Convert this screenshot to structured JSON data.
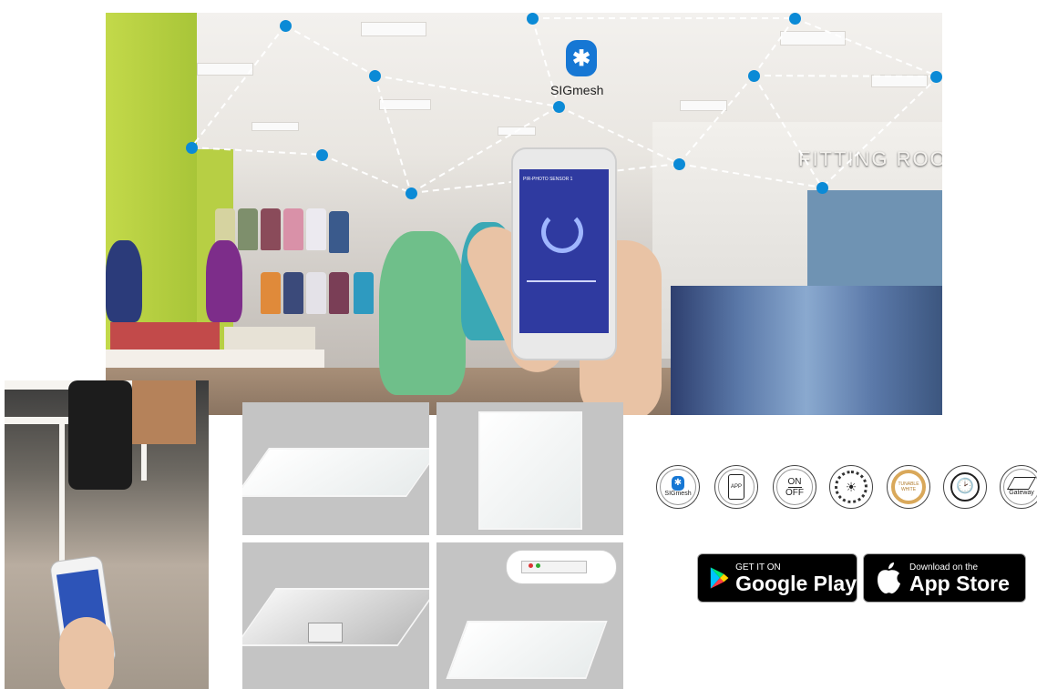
{
  "hero": {
    "protocol_label": "SIGmesh",
    "bluetooth_icon": "bluetooth-icon",
    "sign_text": "FITTING ROO",
    "phone_title": "PIR-PHOTO SENSOR 1"
  },
  "feature_icons": [
    {
      "icon": "bluetooth-icon",
      "label": "SIGmesh"
    },
    {
      "icon": "smartphone-icon",
      "label": "APP"
    },
    {
      "icon": "power-icon",
      "label": "ON",
      "label2": "OFF"
    },
    {
      "icon": "dimming-icon",
      "label": ""
    },
    {
      "icon": "color-temperature-icon",
      "label": "TUNABLE",
      "label2": "WHITE"
    },
    {
      "icon": "clock-icon",
      "label": ""
    },
    {
      "icon": "gateway-icon",
      "label": "Gateway"
    }
  ],
  "stores": {
    "google": {
      "small": "GET IT ON",
      "big": "Google Play",
      "icon": "google-play-icon"
    },
    "apple": {
      "small": "Download on the",
      "big": "App Store",
      "icon": "apple-icon"
    }
  },
  "colors": {
    "accent": "#0b8ad6",
    "app_screen": "#2f3aa0",
    "wall_green": "#b7cf44"
  }
}
